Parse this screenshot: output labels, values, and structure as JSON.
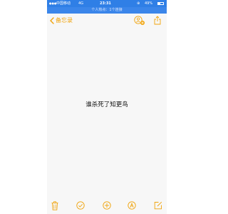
{
  "status_bar": {
    "carrier": "中国移动",
    "network": "4G",
    "time": "23:31",
    "battery_percent": "49%",
    "battery_level": 0.49
  },
  "hotspot_banner": {
    "text": "个人热点：1个连接"
  },
  "nav": {
    "back_label": "备忘录"
  },
  "note": {
    "body": "谁杀死了知更鸟"
  },
  "colors": {
    "accent": "#f0a30a",
    "status_bar": "#2f7fe6",
    "background": "#f7f7f7"
  },
  "toolbar": {
    "icons": [
      "trash-icon",
      "checklist-icon",
      "add-icon",
      "markup-icon",
      "compose-icon"
    ]
  }
}
